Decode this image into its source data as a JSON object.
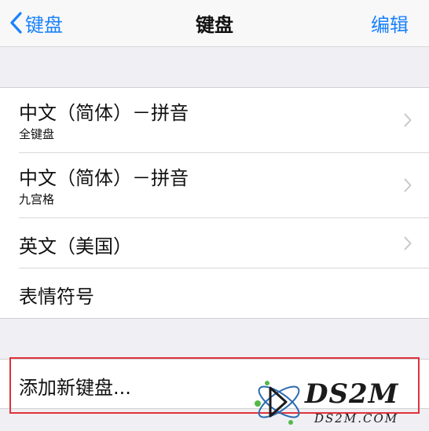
{
  "navbar": {
    "back_label": "键盘",
    "title": "键盘",
    "edit_label": "编辑"
  },
  "keyboards": [
    {
      "title": "中文（简体）－拼音",
      "subtitle": "全键盘"
    },
    {
      "title": "中文（简体）－拼音",
      "subtitle": "九宫格"
    },
    {
      "title": "英文（美国）"
    },
    {
      "title": "表情符号"
    }
  ],
  "add_keyboard_label": "添加新键盘...",
  "watermark": {
    "title": "DS2M",
    "subtitle": "DS2M.COM"
  },
  "colors": {
    "accent": "#1a82fb",
    "background": "#efeff4",
    "highlight_border": "#e0323a"
  }
}
